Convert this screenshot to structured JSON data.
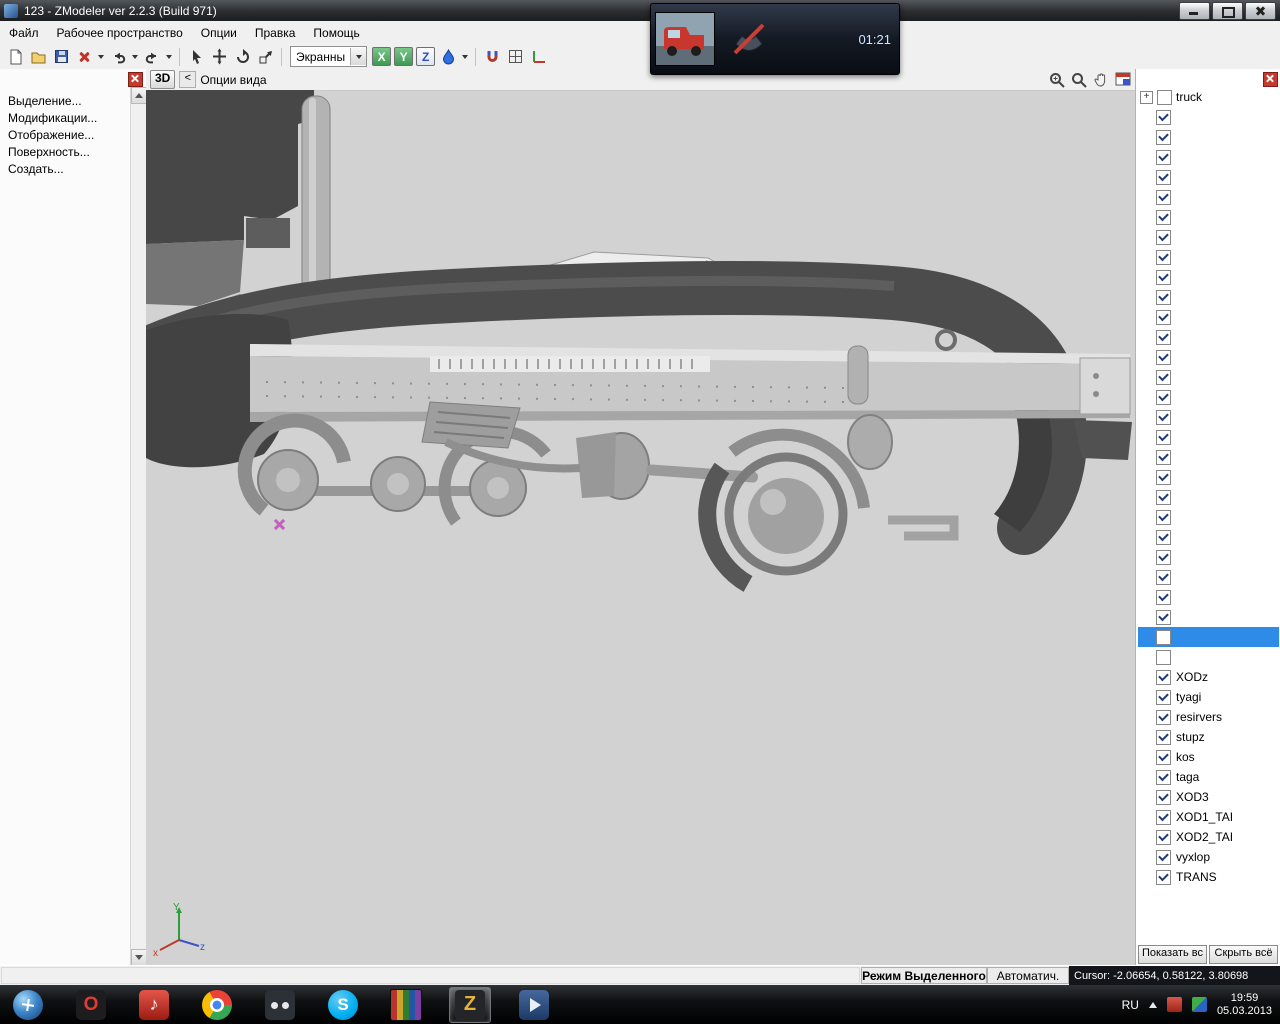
{
  "colors": {
    "selection": "#2f8be8",
    "close-red": "#c63a2d",
    "check": "#1e3c78",
    "viewport-bg": "#d2d2d2"
  },
  "window": {
    "title": "123 - ZModeler ver 2.2.3 (Build 971)"
  },
  "menu": {
    "items": [
      "Файл",
      "Рабочее пространство",
      "Опции",
      "Правка",
      "Помощь"
    ]
  },
  "toolbar": {
    "screen_dropdown_value": "Экранны",
    "axis_x": "X",
    "axis_y": "Y",
    "axis_z": "Z",
    "icons": [
      "new-file-icon",
      "open-file-icon",
      "save-icon",
      "delete-icon",
      "undo-icon",
      "redo-icon",
      "select-tool-icon",
      "move-tool-icon",
      "rotate-tool-icon",
      "scale-tool-icon",
      "material-drop-icon",
      "magnet-icon",
      "grid-icon",
      "axes-icon"
    ]
  },
  "video_overlay": {
    "time": "01:21",
    "icons": [
      "truck-video-thumbnail",
      "phone-muted-icon"
    ]
  },
  "left_panel": {
    "items": [
      "Выделение...",
      "Модификации...",
      "Отображение...",
      "Поверхность...",
      "Создать..."
    ]
  },
  "viewport": {
    "mode": "3D",
    "back": "<",
    "title": "Опции вида",
    "tools": [
      "zoom-in-icon",
      "zoom-icon",
      "pan-hand-icon",
      "maximize-viewport-icon"
    ],
    "gizmo": {
      "y": "Y",
      "z": "z",
      "x": "x"
    }
  },
  "right_panel": {
    "root": {
      "label": "truck",
      "expander": "+",
      "checked": false
    },
    "rows": [
      {
        "checked": true
      },
      {
        "checked": true
      },
      {
        "checked": true
      },
      {
        "checked": true
      },
      {
        "checked": true
      },
      {
        "checked": true
      },
      {
        "checked": true
      },
      {
        "checked": true
      },
      {
        "checked": true
      },
      {
        "checked": true
      },
      {
        "checked": true
      },
      {
        "checked": true
      },
      {
        "checked": true
      },
      {
        "checked": true
      },
      {
        "checked": true
      },
      {
        "checked": true
      },
      {
        "checked": true
      },
      {
        "checked": true
      },
      {
        "checked": true
      },
      {
        "checked": true
      },
      {
        "checked": true
      },
      {
        "checked": true
      },
      {
        "checked": true
      },
      {
        "checked": true
      },
      {
        "checked": true
      },
      {
        "checked": true
      },
      {
        "checked": false,
        "selected": true
      },
      {
        "checked": false
      },
      {
        "checked": true,
        "label": "XODz"
      },
      {
        "checked": true,
        "label": "tyagi"
      },
      {
        "checked": true,
        "label": "resirvers"
      },
      {
        "checked": true,
        "label": "stupz"
      },
      {
        "checked": true,
        "label": "kos"
      },
      {
        "checked": true,
        "label": "taga"
      },
      {
        "checked": true,
        "label": "XOD3"
      },
      {
        "checked": true,
        "label": "XOD1_TAI"
      },
      {
        "checked": true,
        "label": "XOD2_TAI"
      },
      {
        "checked": true,
        "label": "vyxlop"
      },
      {
        "checked": true,
        "label": "TRANS"
      }
    ],
    "show_all": "Показать вс",
    "hide_all": "Скрыть всё"
  },
  "status": {
    "mode": "Режим Выделенного",
    "auto": "Автоматич.",
    "cursor": "Cursor: -2.06654, 0.58122, 3.80698"
  },
  "taskbar": {
    "language": "RU",
    "clock_time": "19:59",
    "clock_date": "05.03.2013",
    "apps": [
      {
        "name": "start-button"
      },
      {
        "name": "opera-icon",
        "glyph": "O"
      },
      {
        "name": "player-icon",
        "glyph": "♪"
      },
      {
        "name": "chrome-icon"
      },
      {
        "name": "glasses-app-icon"
      },
      {
        "name": "skype-icon",
        "glyph": "S"
      },
      {
        "name": "library-icon"
      },
      {
        "name": "zmodeler-icon",
        "glyph": "Z",
        "active": true
      },
      {
        "name": "media-app-icon"
      }
    ],
    "tray_icons": [
      "tray-icon-red",
      "tray-icon-color"
    ]
  }
}
